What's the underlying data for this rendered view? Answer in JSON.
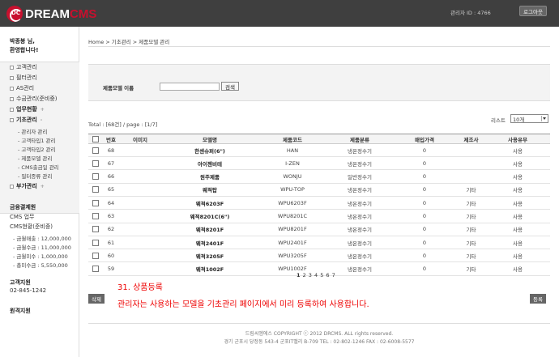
{
  "header": {
    "brand_first": "DREAM",
    "brand_second": "CMS",
    "logo_mark": "DC",
    "admin_id": "관리자 ID : 4766",
    "logout_label": "로그아웃"
  },
  "sidebar": {
    "greeting_line1": "박종봉 님,",
    "greeting_line2": "환영합니다!",
    "items": [
      {
        "label": "고객관리"
      },
      {
        "label": "필터관리"
      },
      {
        "label": "AS관리"
      },
      {
        "label": "수금관리(준비중)"
      }
    ],
    "work_status": "업무현황",
    "basic_mgmt": "기초관리",
    "basic_sub": [
      "- 관리자 관리",
      "- 고객타입1 관리",
      "- 고객타입2 관리",
      "- 제품모델 관리",
      "- CMS출금일 관리",
      "- 필터종류 관리"
    ],
    "extra_mgmt": "부가관리",
    "payment_head": "금융결제원",
    "cms_work": "CMS 업무",
    "cms_status": "CMS현황(준비중)",
    "stats": [
      "- 금월매출 : 12,000,000",
      "- 금월수금 : 11,000,000",
      "- 금월미수 : 1,000,000",
      "- 총미수금 : 5,550,000"
    ],
    "support_head": "고객지원",
    "support_phone": "02-845-1242",
    "remote_head": "원격지원"
  },
  "breadcrumb": "Home > 기초관리 > 제품모델 관리",
  "search": {
    "label": "제품모델 이름",
    "value": "",
    "button": "검색"
  },
  "total_text": "Total : [68건] / page : [1/7]",
  "list_label": "리스트",
  "list_select": "10개",
  "table": {
    "headers": [
      "번호",
      "이미지",
      "모델명",
      "제품코드",
      "제품분류",
      "매입가격",
      "제조사",
      "사용유무"
    ],
    "rows": [
      {
        "no": "68",
        "model": "한센슈퍼(6\")",
        "code": "HAN",
        "cat": "냉온정수기",
        "price": "0",
        "maker": "",
        "use": "사용"
      },
      {
        "no": "67",
        "model": "아이젠비테",
        "code": "I-ZEN",
        "cat": "냉온정수기",
        "price": "0",
        "maker": "",
        "use": "사용"
      },
      {
        "no": "66",
        "model": "원주제품",
        "code": "WONJU",
        "cat": "일반정수기",
        "price": "0",
        "maker": "",
        "use": "사용"
      },
      {
        "no": "65",
        "model": "웨적탑",
        "code": "WPU-TOP",
        "cat": "냉온정수기",
        "price": "0",
        "maker": "기타",
        "use": "사용"
      },
      {
        "no": "64",
        "model": "웨적6203F",
        "code": "WPU6203F",
        "cat": "냉온정수기",
        "price": "0",
        "maker": "기타",
        "use": "사용"
      },
      {
        "no": "63",
        "model": "웨적8201C(6\")",
        "code": "WPU8201C",
        "cat": "냉온정수기",
        "price": "0",
        "maker": "기타",
        "use": "사용"
      },
      {
        "no": "62",
        "model": "웨적8201F",
        "code": "WPU8201F",
        "cat": "냉온정수기",
        "price": "0",
        "maker": "기타",
        "use": "사용"
      },
      {
        "no": "61",
        "model": "웨적2401F",
        "code": "WPU2401F",
        "cat": "냉온정수기",
        "price": "0",
        "maker": "기타",
        "use": "사용"
      },
      {
        "no": "60",
        "model": "웨적3205F",
        "code": "WPU3205F",
        "cat": "냉온정수기",
        "price": "0",
        "maker": "기타",
        "use": "사용"
      },
      {
        "no": "59",
        "model": "웨적1002F",
        "code": "WPU1002F",
        "cat": "냉온정수기",
        "price": "0",
        "maker": "기타",
        "use": "사용"
      }
    ]
  },
  "pager": {
    "current": "1",
    "others": "2 3 4 5 6 7"
  },
  "delete_label": "삭제",
  "register_label": "등록",
  "note": {
    "title": "31. 상품등록",
    "text": "관리자는 사용하는 모델을 기초관리 페이지에서 미리 등록하여 사용합니다."
  },
  "footer": {
    "copyright": "드림씨엠에스 COPYRIGHT ⓒ 2012 DRCMS. ALL rights reserved.",
    "address": "경기 군포시 당정동 543-4 군포IT밸리 B-709  TEL : 02-802-1246  FAX : 02-6008-5577"
  },
  "colors": {
    "header_bg": "#3f3f3f",
    "brand_red": "#c8102e",
    "note_red": "#e00000"
  }
}
